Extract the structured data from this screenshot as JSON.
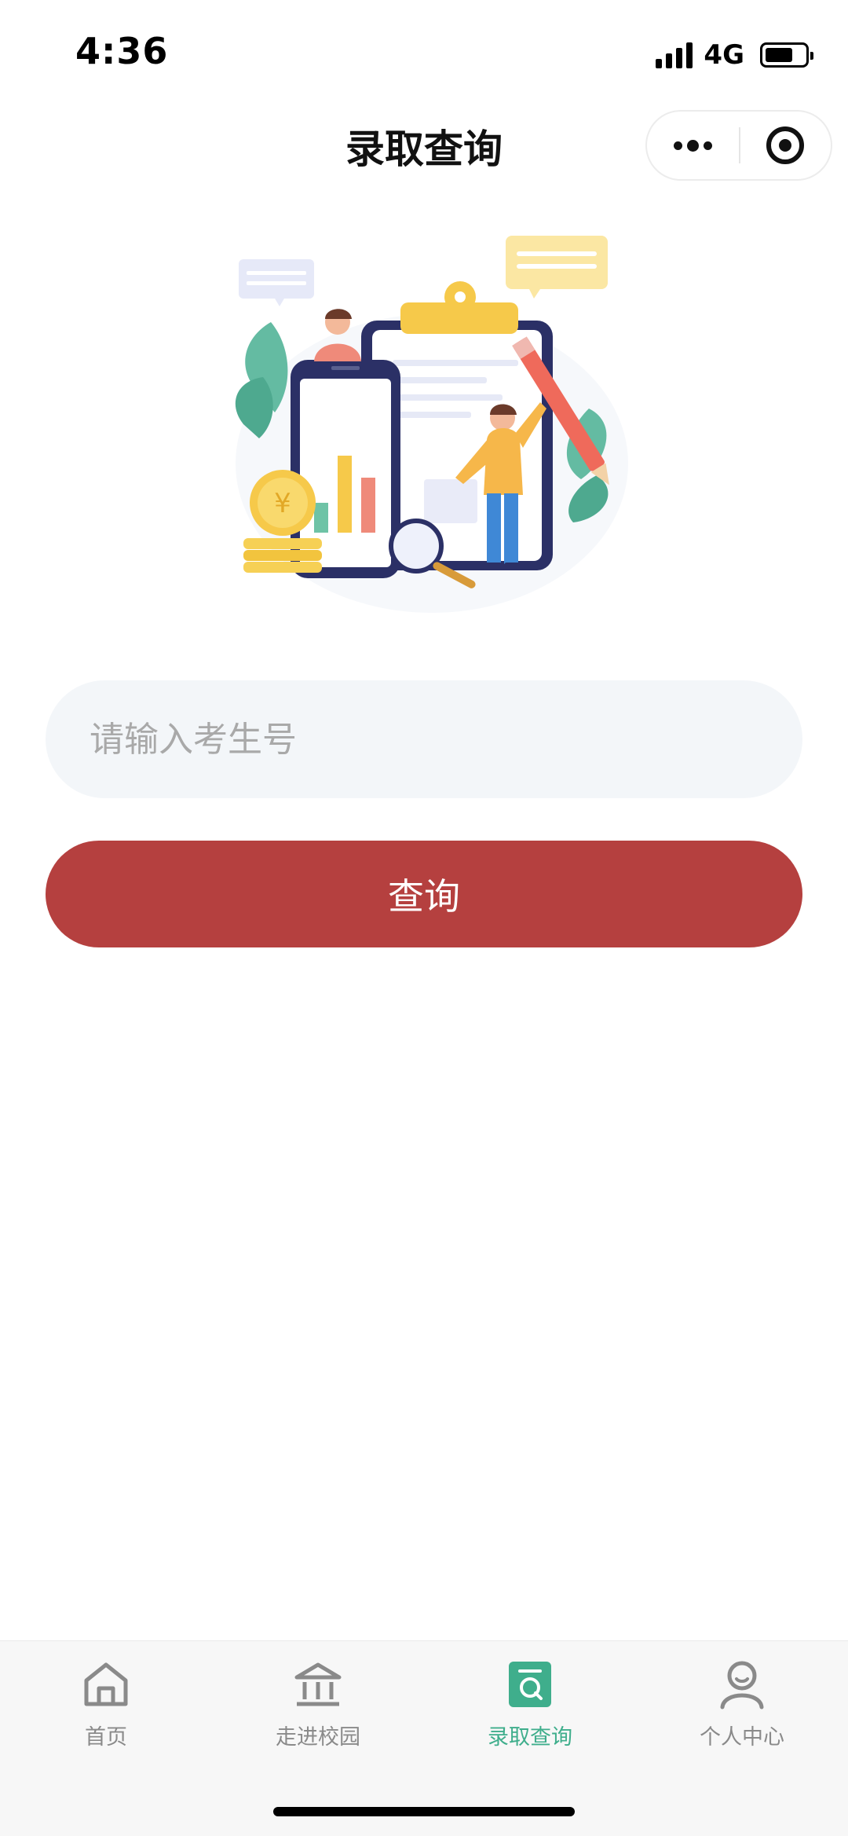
{
  "status_bar": {
    "time": "4:36",
    "network": "4G",
    "battery_level": 0.7
  },
  "nav": {
    "title": "录取查询"
  },
  "search": {
    "placeholder": "请输入考生号",
    "value": ""
  },
  "query_button_label": "查询",
  "tab_bar": {
    "items": [
      {
        "label": "首页",
        "icon": "home-icon",
        "active": false
      },
      {
        "label": "走进校园",
        "icon": "campus-icon",
        "active": false
      },
      {
        "label": "录取查询",
        "icon": "admission-query-icon",
        "active": true
      },
      {
        "label": "个人中心",
        "icon": "user-icon",
        "active": false
      }
    ]
  },
  "colors": {
    "accent": "#b5403f",
    "tab_active": "#3fae8c",
    "tab_inactive": "#8a8a8a",
    "input_bg": "#f3f6f9"
  }
}
